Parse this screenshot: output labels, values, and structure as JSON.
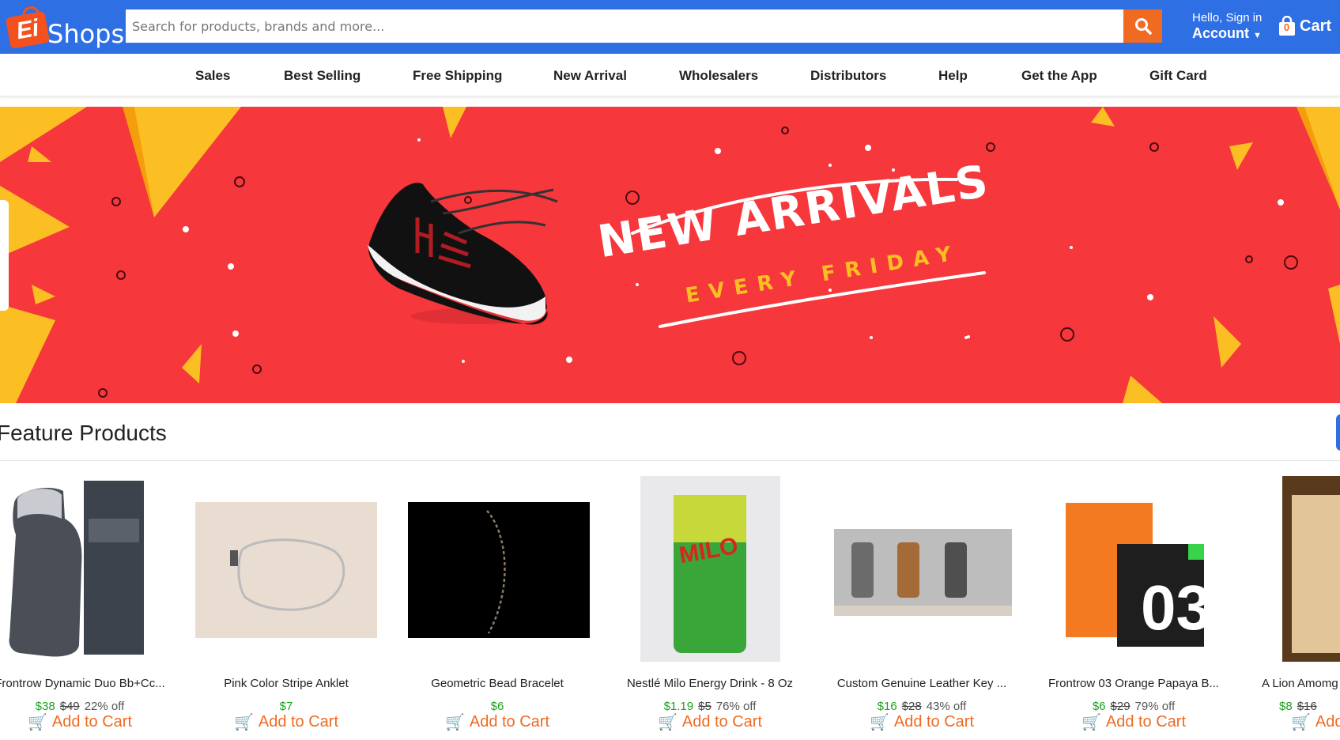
{
  "header": {
    "logo_badge": "Ei",
    "logo_text": "Shops",
    "search_placeholder": "Search for products, brands and more...",
    "greeting": "Hello, Sign in",
    "account_label": "Account",
    "cart_label": "Cart",
    "cart_count": "0"
  },
  "nav": {
    "items": [
      "Sales",
      "Best Selling",
      "Free Shipping",
      "New Arrival",
      "Wholesalers",
      "Distributors",
      "Help",
      "Get the App",
      "Gift Card"
    ]
  },
  "banner": {
    "headline": "NEW ARRIVALS",
    "subline": "EVERY FRIDAY",
    "bg_color": "#f6373c",
    "accent_color": "#fbbf24"
  },
  "feature": {
    "title": "Feature Products"
  },
  "products": [
    {
      "name": "Frontrow Dynamic Duo Bb+Cc...",
      "price": "$38",
      "old_price": "$49",
      "discount": "22% off",
      "cta": "Add to Cart"
    },
    {
      "name": "Pink Color Stripe Anklet",
      "price": "$7",
      "old_price": "",
      "discount": "",
      "cta": "Add to Cart"
    },
    {
      "name": "Geometric Bead Bracelet",
      "price": "$6",
      "old_price": "",
      "discount": "",
      "cta": "Add to Cart"
    },
    {
      "name": "Nestlé Milo Energy Drink - 8 Oz",
      "price": "$1.19",
      "old_price": "$5",
      "discount": "76% off",
      "cta": "Add to Cart"
    },
    {
      "name": "Custom Genuine Leather Key ...",
      "price": "$16",
      "old_price": "$28",
      "discount": "43% off",
      "cta": "Add to Cart"
    },
    {
      "name": "Frontrow 03 Orange Papaya B...",
      "price": "$6",
      "old_price": "$29",
      "discount": "79% off",
      "cta": "Add to Cart"
    },
    {
      "name": "A Lion Amomg",
      "price": "$8",
      "old_price": "$16",
      "discount": "",
      "cta": "Add to Cart"
    }
  ],
  "colors": {
    "header_blue": "#2f6fe4",
    "accent_orange": "#f06a22",
    "price_green": "#1aa31a"
  }
}
